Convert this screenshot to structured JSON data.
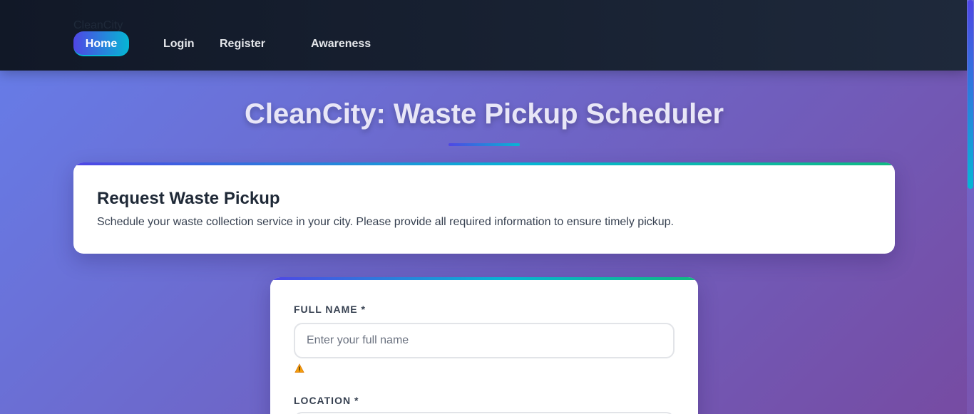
{
  "navbar": {
    "brand": "CleanCity",
    "links": [
      "Home",
      "Login",
      "Register",
      "Awareness"
    ]
  },
  "page": {
    "title": "CleanCity: Waste Pickup Scheduler"
  },
  "intro_card": {
    "heading": "Request Waste Pickup",
    "description": "Schedule your waste collection service in your city. Please provide all required information to ensure timely pickup."
  },
  "form": {
    "full_name": {
      "label": "FULL NAME *",
      "placeholder": "Enter your full name",
      "value": ""
    },
    "location": {
      "label": "LOCATION *"
    },
    "warning_icon": "warning-icon"
  },
  "colors": {
    "nav_bg": "#111827",
    "accent_start": "#4f46e5",
    "accent_end": "#06b6d4",
    "accent_green": "#10b981",
    "bg_start": "#667eea",
    "bg_end": "#764ba2",
    "warning": "#f59e0b"
  }
}
